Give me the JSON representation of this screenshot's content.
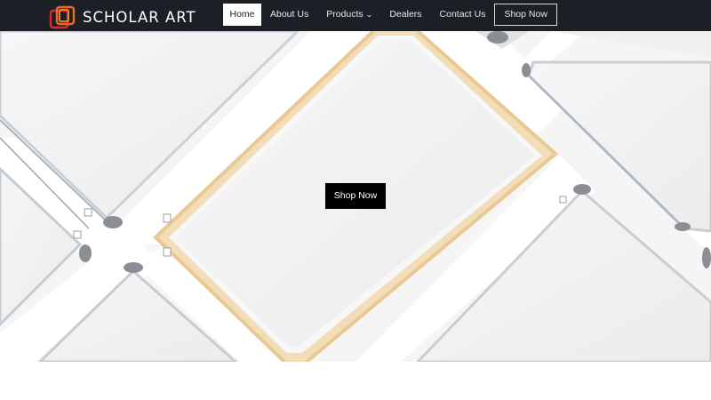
{
  "brand": {
    "name": "SCHOLAR ART",
    "logo_icon": "stacked-frames-icon",
    "colors": {
      "orange": "#f26a21",
      "red": "#e0282b"
    }
  },
  "navbar": {
    "background": "#1c1f26",
    "items": [
      {
        "label": "Home",
        "active": true
      },
      {
        "label": "About Us"
      },
      {
        "label": "Products",
        "has_dropdown": true,
        "dropdown_icon": "chevron-down-icon"
      },
      {
        "label": "Dealers"
      },
      {
        "label": "Contact Us"
      }
    ],
    "shop_button": "Shop Now"
  },
  "hero": {
    "cta_label": "Shop Now"
  }
}
